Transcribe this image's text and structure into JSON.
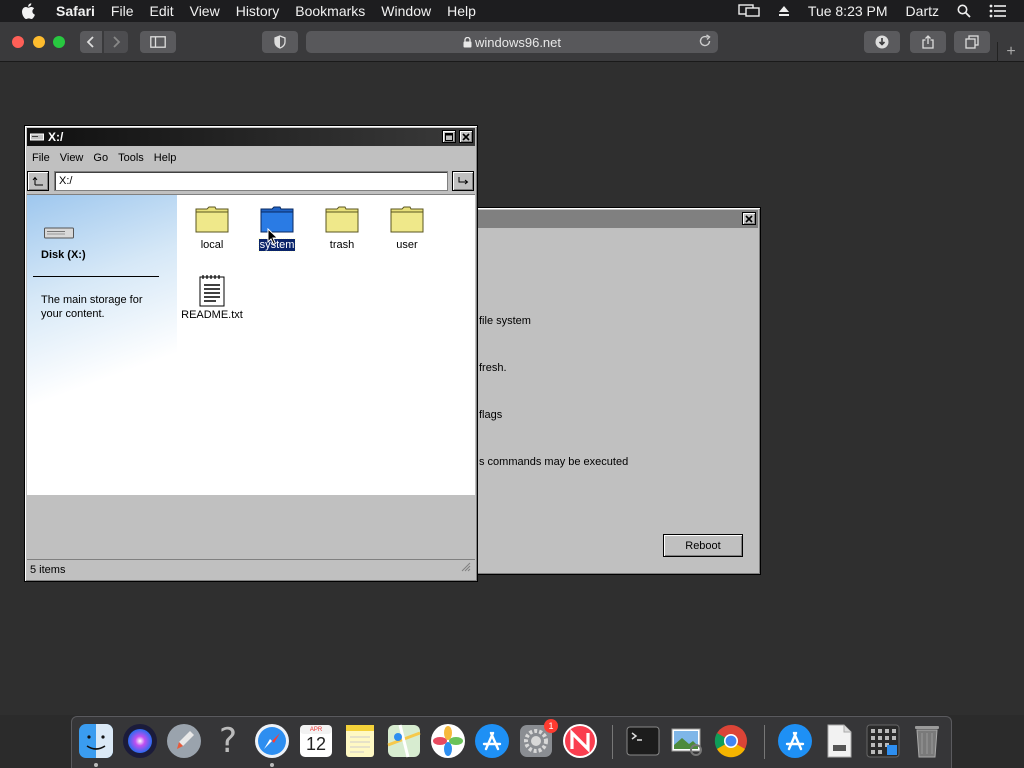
{
  "menubar": {
    "app": "Safari",
    "items": [
      "File",
      "Edit",
      "View",
      "History",
      "Bookmarks",
      "Window",
      "Help"
    ],
    "clock": "Tue 8:23 PM",
    "user": "Dartz"
  },
  "browser": {
    "url": "windows96.net"
  },
  "explorer": {
    "title": "X:/",
    "menu": [
      "File",
      "View",
      "Go",
      "Tools",
      "Help"
    ],
    "address": "X:/",
    "side_title": "Disk (X:)",
    "side_desc": "The main storage for your content.",
    "items": [
      {
        "label": "local",
        "type": "folder"
      },
      {
        "label": "system",
        "type": "folder",
        "selected": true
      },
      {
        "label": "trash",
        "type": "folder"
      },
      {
        "label": "user",
        "type": "folder"
      },
      {
        "label": "README.txt",
        "type": "text"
      }
    ],
    "status": "5 items"
  },
  "dialog": {
    "lines": [
      "file system",
      "fresh.",
      "flags",
      "s commands may be executed"
    ],
    "reboot_label": "Reboot"
  },
  "dock": {
    "calendar_month": "APR",
    "calendar_day": "12",
    "badge_count": "1",
    "apps": [
      "finder",
      "siri",
      "launchpad",
      "help",
      "safari",
      "calendar",
      "notes",
      "maps",
      "photos",
      "app-store",
      "system-preferences",
      "news",
      "terminal",
      "preview",
      "chrome",
      "app-store-alt",
      "document",
      "grid",
      "trash"
    ]
  },
  "colors": {
    "selection": "#0a246a",
    "folder_yellow": "#e8e07a",
    "folder_blue": "#2a7be4",
    "dialog_bg": "#c0c0c0"
  }
}
